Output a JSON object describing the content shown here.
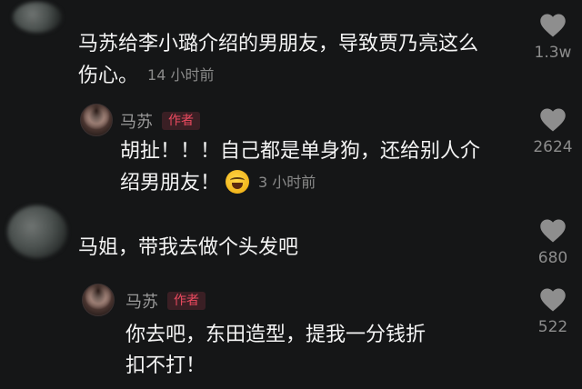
{
  "comments": [
    {
      "text": "马苏给李小璐介绍的男朋友，导致贾乃亮这么伤心。",
      "line1": "马苏给李小璐介绍的男朋友，导致贾乃亮这么",
      "line2": "伤心。",
      "time": "14 小时前",
      "likes": "1.3w",
      "reply": {
        "name": "马苏",
        "badge": "作者",
        "line1": "胡扯！！！自己都是单身狗，还给别人介",
        "line2": "绍男朋友！",
        "emoji": "laughing-crying-emoji",
        "time": "3 小时前",
        "likes": "2624"
      }
    },
    {
      "line1": "马姐，带我去做个头发吧",
      "likes": "680",
      "reply": {
        "name": "马苏",
        "badge": "作者",
        "line1": "你去吧，东田造型，提我一分钱折",
        "line2": "扣不打！",
        "likes": "522"
      }
    }
  ],
  "colors": {
    "background": "#151617",
    "badge_text": "#ea4a5f",
    "badge_bg": "#3a1f24",
    "meta": "#8a8a8a"
  }
}
